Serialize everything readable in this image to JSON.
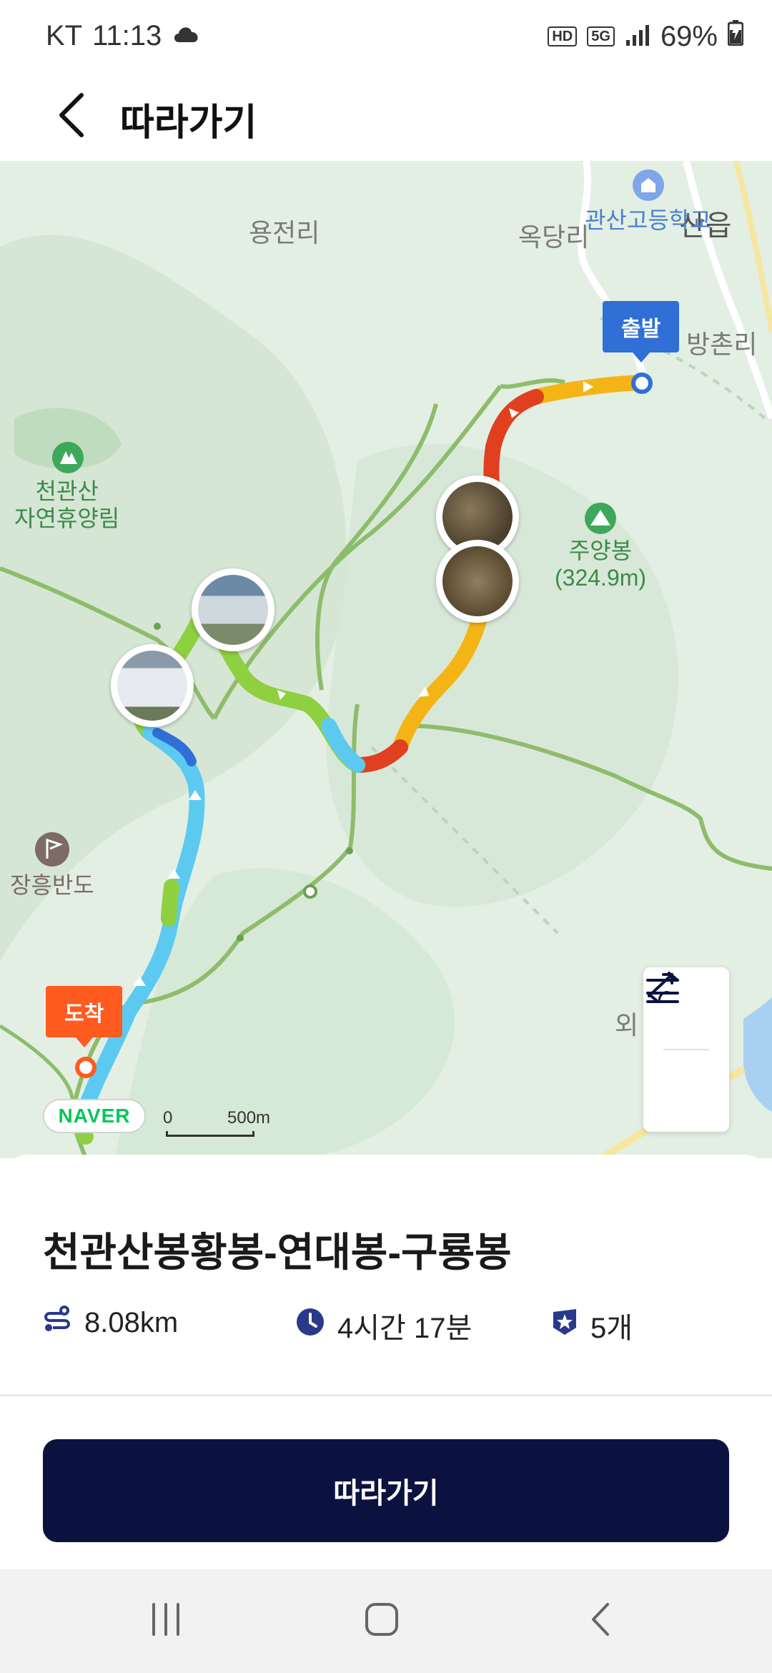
{
  "status_bar": {
    "carrier": "KT",
    "time": "11:13",
    "hd_label": "HD",
    "network": "5G",
    "battery": "69%"
  },
  "header": {
    "title": "따라가기",
    "back_icon": "chevron-left-icon"
  },
  "map": {
    "place_labels": {
      "yongjeonri": "용전리",
      "okdangri": "옥당리",
      "sanup": "산읍",
      "bangchonri": "방촌리",
      "oe": "외"
    },
    "poi": {
      "school": "관산고등학교",
      "forest_line1": "천관산",
      "forest_line2": "자연휴양림",
      "peak_name": "주양봉",
      "peak_height": "(324.9m)",
      "jangheung": "장흥반도"
    },
    "start_pin": "출발",
    "end_pin": "도착",
    "naver_badge": "NAVER",
    "scale": {
      "zero": "0",
      "max": "500m"
    },
    "controls": [
      "elevation-icon",
      "swap-direction-icon"
    ]
  },
  "route": {
    "name": "천관산봉황봉-연대봉-구룡봉",
    "distance": "8.08km",
    "duration": "4시간 17분",
    "count": "5개",
    "icons": [
      "route-icon",
      "clock-icon",
      "badge-star-icon"
    ]
  },
  "action": {
    "follow_button": "따라가기"
  },
  "nav_bar": [
    "recents-icon",
    "home-icon",
    "back-icon"
  ],
  "colors": {
    "accent_navy": "#0b1240",
    "start_blue": "#2f6fd6",
    "end_orange": "#ff5a1f",
    "naver_green": "#03c75a",
    "map_bg": "#e3efe3"
  }
}
